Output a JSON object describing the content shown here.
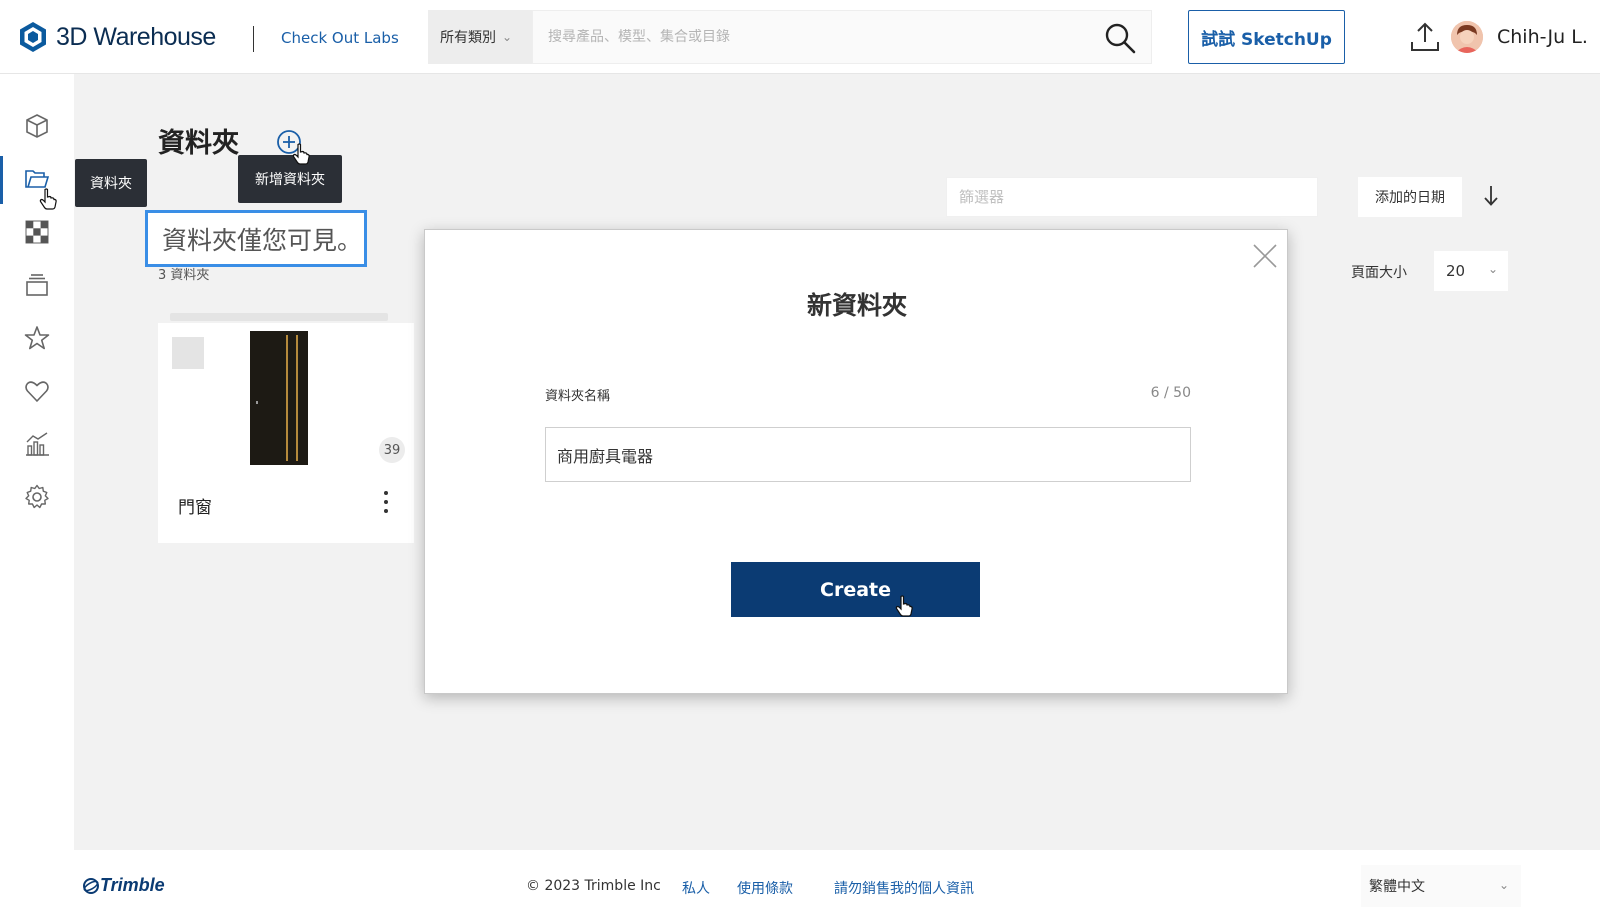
{
  "header": {
    "logo_text": "3D Warehouse",
    "labs_link": "Check Out Labs",
    "category_select": "所有類別",
    "search_placeholder": "搜尋產品、模型、集合或目錄",
    "try_button": "試試 SketchUp",
    "user_name": "Chih-Ju L."
  },
  "sidebar": {
    "items": [
      {
        "icon": "cube-icon",
        "label": "models"
      },
      {
        "icon": "folder-icon",
        "label": "資料夾",
        "active": true
      },
      {
        "icon": "checker-icon",
        "label": "materials"
      },
      {
        "icon": "stack-icon",
        "label": "collections"
      },
      {
        "icon": "star-icon",
        "label": "favorites"
      },
      {
        "icon": "heart-icon",
        "label": "likes"
      },
      {
        "icon": "chart-icon",
        "label": "analytics"
      },
      {
        "icon": "gear-icon",
        "label": "settings"
      }
    ],
    "tooltip": "資料夾"
  },
  "main": {
    "title": "資料夾",
    "add_tooltip": "新增資料夾",
    "visibility_note": "資料夾僅您可見。",
    "folder_count": "3 資料夾",
    "filter_placeholder": "篩選器",
    "sort_label": "添加的日期",
    "page_size_label": "頁面大小",
    "page_size_value": "20",
    "folders": [
      {
        "name": "門窗",
        "count": "39"
      }
    ]
  },
  "modal": {
    "title": "新資料夾",
    "field_label": "資料夾名稱",
    "counter": "6 / 50",
    "input_value": "商用廚具電器",
    "create_button": "Create"
  },
  "footer": {
    "brand": "Trimble",
    "copyright": "© 2023 Trimble Inc",
    "links": [
      "私人",
      "使用條款",
      "請勿銷售我的個人資訊"
    ],
    "language": "繁體中文"
  },
  "colors": {
    "brand_blue": "#1a5fa8",
    "primary_button": "#0b3b73",
    "highlight_border": "#3a8ee6"
  }
}
